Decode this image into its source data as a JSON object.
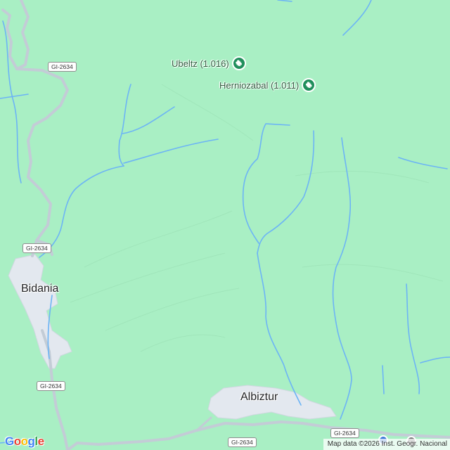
{
  "map": {
    "background": "#a9efc4",
    "river_color": "#6cb4f5",
    "town_color": "#e3e8ef",
    "road_color": "#c3ccd6"
  },
  "towns": {
    "bidania": "Bidania",
    "albiztur": "Albiztur"
  },
  "peaks": {
    "ubeltz": "Ubeltz (1.016)",
    "herniozabal": "Herniozabal (1.011)"
  },
  "peak_icon": "hiking-icon",
  "roads": {
    "gi2634_top": "GI-2634",
    "gi2634_mid": "GI-2634",
    "gi2634_low": "GI-2634",
    "gi2634_bottom": "GI-2634",
    "gi2634_right": "GI-2634"
  },
  "footer": {
    "logo": "Google",
    "attribution": "Map data ©2026 Inst. Geogr. Nacional"
  }
}
